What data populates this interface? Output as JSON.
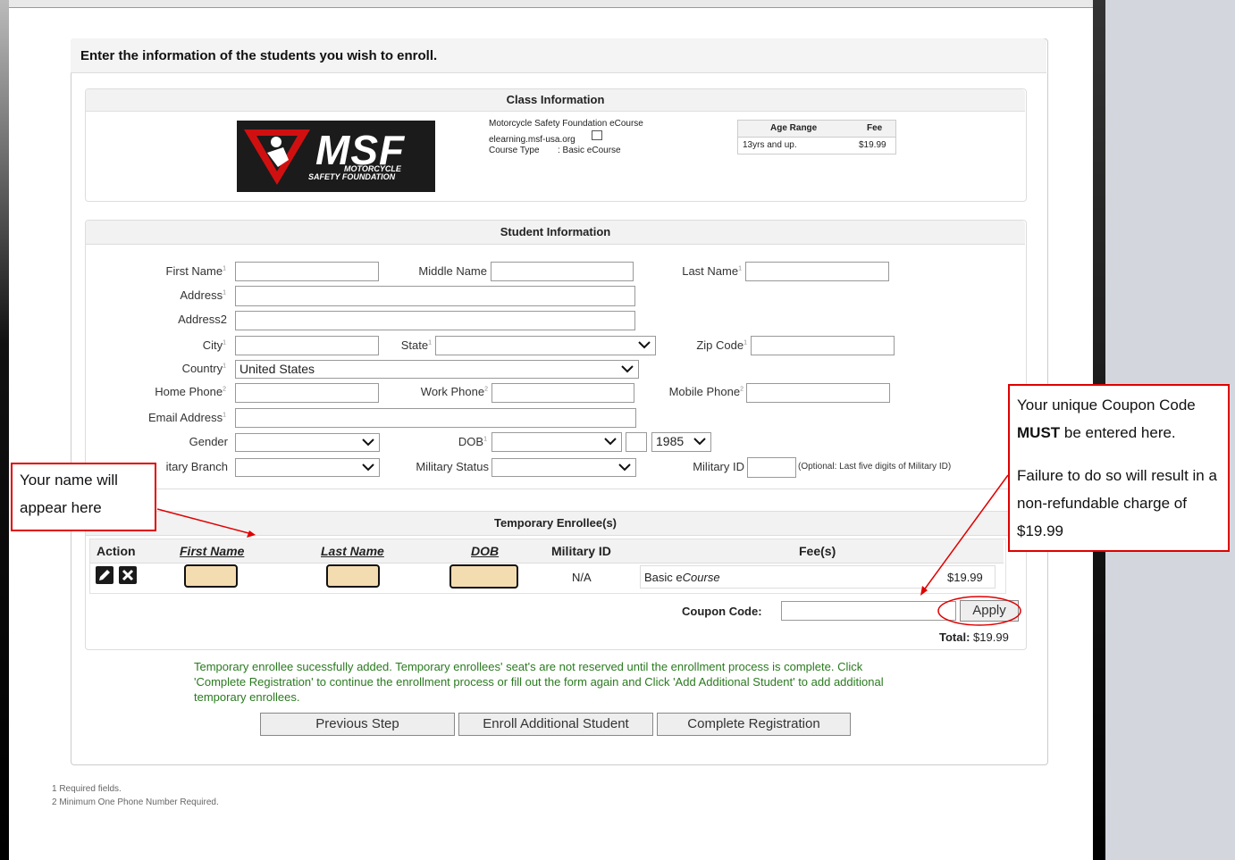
{
  "page": {
    "heading": "Enter the information of the students you wish to enroll."
  },
  "class_info": {
    "title": "Class Information",
    "logo": {
      "main": "MSF",
      "line1": "MOTORCYCLE",
      "line2": "SAFETY FOUNDATION",
      "mark": "®"
    },
    "course_name": "Motorcycle Safety Foundation eCourse",
    "website": "elearning.msf-usa.org",
    "course_type_label": "Course Type",
    "course_type_value": ": Basic eCourse",
    "age_header": "Age Range",
    "fee_header": "Fee",
    "age_value": "13yrs and up.",
    "fee_value": "$19.99"
  },
  "student_info": {
    "title": "Student Information",
    "first_name": "First Name",
    "middle_name": "Middle Name",
    "last_name": "Last Name",
    "address": "Address",
    "address2": "Address2",
    "city": "City",
    "state": "State",
    "zip": "Zip Code",
    "country": "Country",
    "country_value": "United States",
    "home_phone": "Home Phone",
    "work_phone": "Work Phone",
    "mobile_phone": "Mobile Phone",
    "email": "Email Address",
    "gender": "Gender",
    "dob": "DOB",
    "dob_year": "1985",
    "military_branch": "itary Branch",
    "military_status": "Military Status",
    "military_id": "Military ID",
    "military_id_hint": "(Optional: Last five digits of Military ID)",
    "sup1": "1",
    "sup2": "2"
  },
  "enrollees": {
    "title": "Temporary Enrollee(s)",
    "columns": [
      "Action",
      "First Name",
      "Last Name",
      "DOB",
      "Military ID",
      "Fee(s)"
    ],
    "row": {
      "military_id": "N/A",
      "fee_name_prefix": "Basic e",
      "fee_name_italic": "Course",
      "fee_amount": "$19.99"
    },
    "coupon_label": "Coupon Code:",
    "apply_label": "Apply",
    "total_label": "Total:",
    "total_value": "$19.99"
  },
  "message": "Temporary enrollee sucessfully added. Temporary enrollees' seat's are not reserved until the enrollment process is complete. Click 'Complete Registration' to continue the enrollment process or fill out the form again and Click 'Add Additional Student' to add additional temporary enrollees.",
  "buttons": {
    "previous": "Previous Step",
    "enroll_additional": "Enroll Additional Student",
    "complete": "Complete Registration"
  },
  "footnotes": {
    "one": "1 Required fields.",
    "two": "2 Minimum One Phone Number Required."
  },
  "annotations": {
    "name_note": "Your name will appear here",
    "coupon_note_line1": "Your unique Coupon Code",
    "coupon_note_bold": "MUST",
    "coupon_note_line2": " be entered here.",
    "coupon_note_line3": "Failure to do so will result in a non-refundable charge of $19.99"
  },
  "colors": {
    "annotation_red": "#e00000",
    "message_green": "#2a7a1f",
    "tan_highlight": "#f3dcb0"
  }
}
